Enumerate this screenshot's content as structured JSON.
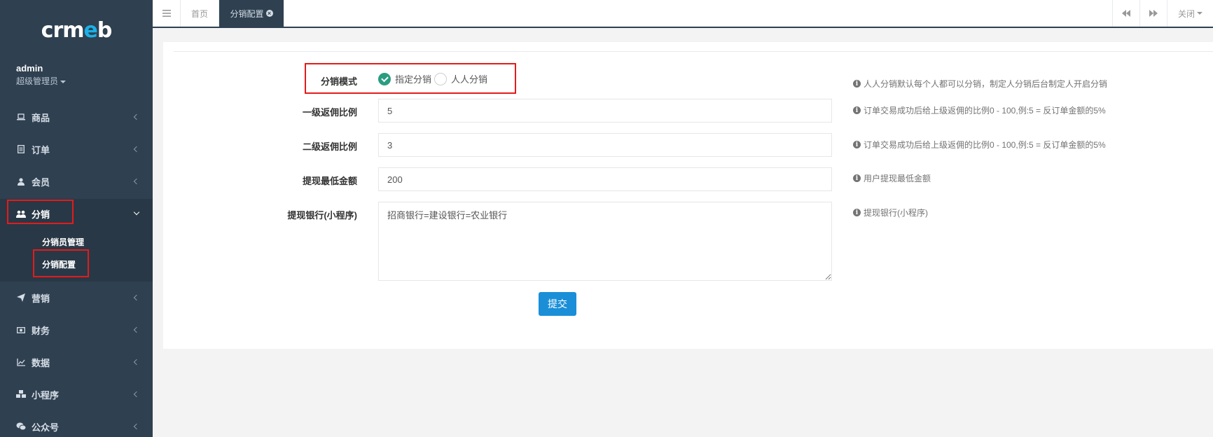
{
  "app": {
    "logo_text_start": "crm",
    "logo_text_accent": "e",
    "logo_text_end": "b"
  },
  "profile": {
    "name": "admin",
    "role": "超级管理员"
  },
  "sidebar": {
    "items": [
      {
        "label": "商品",
        "icon": "laptop-icon"
      },
      {
        "label": "订单",
        "icon": "file-icon"
      },
      {
        "label": "会员",
        "icon": "user-icon"
      },
      {
        "label": "分销",
        "icon": "users-icon"
      },
      {
        "label": "营销",
        "icon": "paper-plane-icon"
      },
      {
        "label": "财务",
        "icon": "money-icon"
      },
      {
        "label": "数据",
        "icon": "line-chart-icon"
      },
      {
        "label": "小程序",
        "icon": "cubes-icon"
      },
      {
        "label": "公众号",
        "icon": "wechat-icon"
      }
    ],
    "submenu": [
      {
        "label": "分销员管理"
      },
      {
        "label": "分销配置"
      }
    ]
  },
  "topbar": {
    "tabs": [
      {
        "label": "首页"
      },
      {
        "label": "分销配置"
      }
    ],
    "close_label": "关闭"
  },
  "form": {
    "mode": {
      "label": "分销模式",
      "options": [
        "指定分销",
        "人人分销"
      ],
      "hint": "人人分销默认每个人都可以分销，制定人分销后台制定人开启分销"
    },
    "level1": {
      "label": "一级返佣比例",
      "value": "5",
      "hint": "订单交易成功后给上级返佣的比例0 - 100,例:5 = 反订单金额的5%"
    },
    "level2": {
      "label": "二级返佣比例",
      "value": "3",
      "hint": "订单交易成功后给上级返佣的比例0 - 100,例:5 = 反订单金额的5%"
    },
    "min_withdraw": {
      "label": "提现最低金额",
      "value": "200",
      "hint": "用户提现最低金额"
    },
    "banks": {
      "label": "提现银行(小程序)",
      "value": "招商银行=建设银行=农业银行",
      "hint": "提现银行(小程序)"
    },
    "submit_label": "提交"
  },
  "colors": {
    "sidebar_bg": "#2f4050",
    "accent_green": "#2a9d80",
    "primary_blue": "#1a8fd8",
    "highlight_red": "#e41b1b"
  }
}
